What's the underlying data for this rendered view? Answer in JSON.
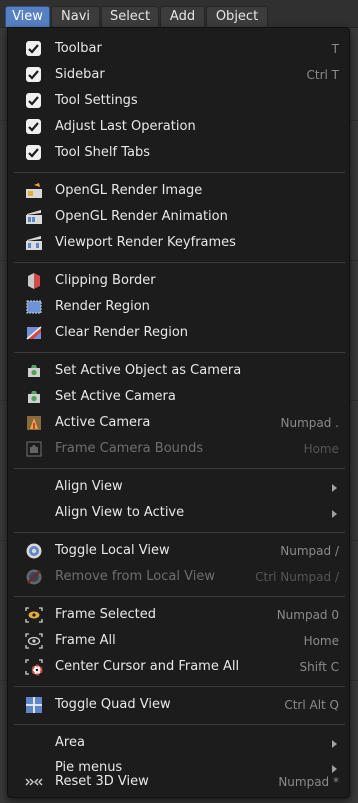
{
  "header": {
    "tabs": [
      "View",
      "Navi",
      "Select",
      "Add",
      "Object"
    ],
    "active_tab": "View"
  },
  "menu": {
    "items": [
      {
        "label": "Toolbar",
        "shortcut": "T",
        "icon": "checkbox-checked-icon"
      },
      {
        "label": "Sidebar",
        "shortcut": "Ctrl T",
        "icon": "checkbox-checked-icon"
      },
      {
        "label": "Tool Settings",
        "shortcut": "",
        "icon": "checkbox-checked-icon"
      },
      {
        "label": "Adjust Last Operation",
        "shortcut": "",
        "icon": "checkbox-checked-icon"
      },
      {
        "label": "Tool Shelf Tabs",
        "shortcut": "",
        "icon": "checkbox-checked-icon"
      },
      {
        "label": "OpenGL Render Image",
        "shortcut": "",
        "icon": "render-image-icon"
      },
      {
        "label": "OpenGL Render Animation",
        "shortcut": "",
        "icon": "render-animation-icon"
      },
      {
        "label": "Viewport Render Keyframes",
        "shortcut": "",
        "icon": "render-keyframes-icon"
      },
      {
        "label": "Clipping Border",
        "shortcut": "",
        "icon": "clipping-border-icon"
      },
      {
        "label": "Render Region",
        "shortcut": "",
        "icon": "render-region-icon"
      },
      {
        "label": "Clear Render Region",
        "shortcut": "",
        "icon": "clear-render-region-icon"
      },
      {
        "label": "Set Active Object as Camera",
        "shortcut": "",
        "icon": "camera-object-icon"
      },
      {
        "label": "Set Active Camera",
        "shortcut": "",
        "icon": "camera-object-icon"
      },
      {
        "label": "Active Camera",
        "shortcut": "Numpad .",
        "icon": "active-camera-icon"
      },
      {
        "label": "Frame Camera Bounds",
        "shortcut": "Home",
        "icon": "frame-camera-bounds-icon",
        "disabled": true
      },
      {
        "label": "Align View",
        "shortcut": "",
        "icon": "",
        "submenu": true
      },
      {
        "label": "Align View to Active",
        "shortcut": "",
        "icon": "",
        "submenu": true
      },
      {
        "label": "Toggle Local View",
        "shortcut": "Numpad /",
        "icon": "local-view-icon"
      },
      {
        "label": "Remove from Local View",
        "shortcut": "Ctrl Numpad /",
        "icon": "remove-local-view-icon",
        "disabled": true
      },
      {
        "label": "Frame Selected",
        "shortcut": "Numpad 0",
        "icon": "frame-selected-icon"
      },
      {
        "label": "Frame All",
        "shortcut": "Home",
        "icon": "frame-all-icon"
      },
      {
        "label": "Center Cursor and Frame All",
        "shortcut": "Shift C",
        "icon": "center-cursor-icon"
      },
      {
        "label": "Toggle Quad View",
        "shortcut": "Ctrl Alt Q",
        "icon": "quad-view-icon"
      },
      {
        "label": "Area",
        "shortcut": "",
        "icon": "",
        "submenu": true
      },
      {
        "label": "Pie menus",
        "shortcut": "",
        "icon": "",
        "submenu": true
      },
      {
        "label": "Reset 3D View",
        "shortcut": "Numpad *",
        "icon": "reset-3d-view-icon"
      }
    ]
  },
  "colors": {
    "menu_bg": "#1c1c1c",
    "active_tab": "#5680c2",
    "text": "#e8e8e8",
    "shortcut_text": "#8a8a8a"
  }
}
